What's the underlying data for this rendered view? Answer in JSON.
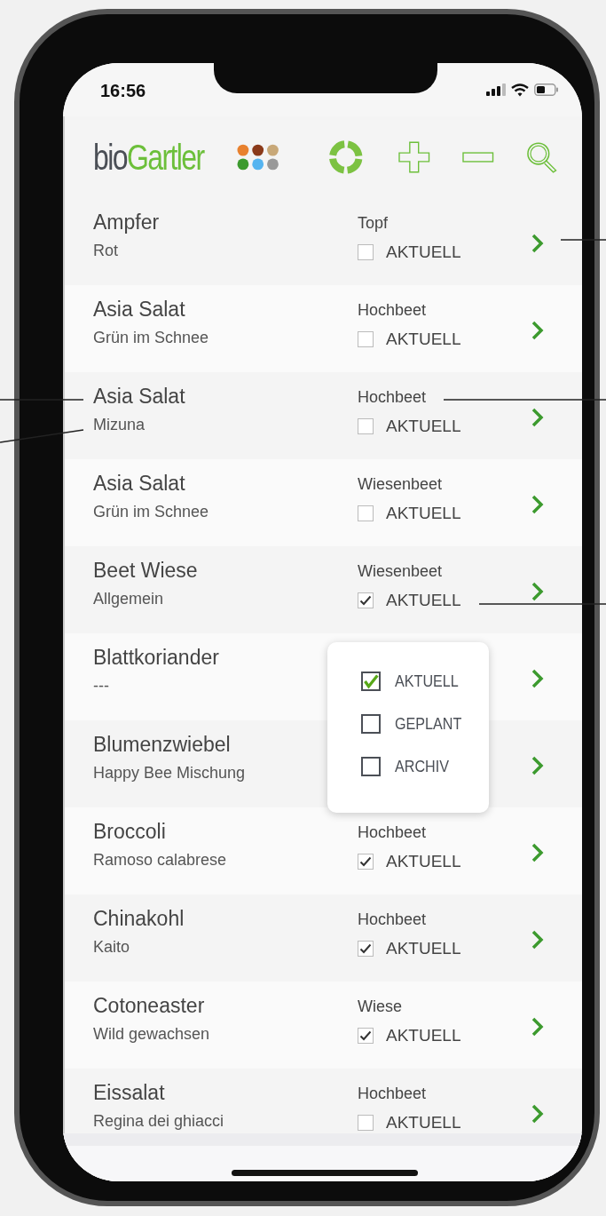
{
  "status_bar": {
    "time": "16:56"
  },
  "header": {
    "logo": [
      "bio",
      "Gartler"
    ]
  },
  "rows": [
    {
      "name": "Ampfer",
      "variety": "Rot",
      "location": "Topf",
      "status": "AKTUELL",
      "checked": false
    },
    {
      "name": "Asia Salat",
      "variety": "Grün im Schnee",
      "location": "Hochbeet",
      "status": "AKTUELL",
      "checked": false
    },
    {
      "name": "Asia Salat",
      "variety": "Mizuna",
      "location": "Hochbeet",
      "status": "AKTUELL",
      "checked": false
    },
    {
      "name": "Asia Salat",
      "variety": "Grün im Schnee",
      "location": "Wiesenbeet",
      "status": "AKTUELL",
      "checked": false
    },
    {
      "name": "Beet Wiese",
      "variety": "Allgemein",
      "location": "Wiesenbeet",
      "status": "AKTUELL",
      "checked": true
    },
    {
      "name": "Blattkoriander",
      "variety": "---"
    },
    {
      "name": "Blumenzwiebel",
      "variety": "Happy Bee Mischung"
    },
    {
      "name": "Broccoli",
      "variety": "Ramoso calabrese",
      "location": "Hochbeet",
      "status": "AKTUELL",
      "checked": true
    },
    {
      "name": "Chinakohl",
      "variety": "Kaito",
      "location": "Hochbeet",
      "status": "AKTUELL",
      "checked": true
    },
    {
      "name": "Cotoneaster",
      "variety": "Wild gewachsen",
      "location": "Wiese",
      "status": "AKTUELL",
      "checked": true
    },
    {
      "name": "Eissalat",
      "variety": "Regina dei ghiacci",
      "location": "Hochbeet",
      "status": "AKTUELL",
      "checked": false
    }
  ],
  "filter_menu": [
    {
      "label": "AKTUELL",
      "checked": true
    },
    {
      "label": "GEPLANT",
      "checked": false
    },
    {
      "label": "ARCHIV",
      "checked": false
    }
  ]
}
